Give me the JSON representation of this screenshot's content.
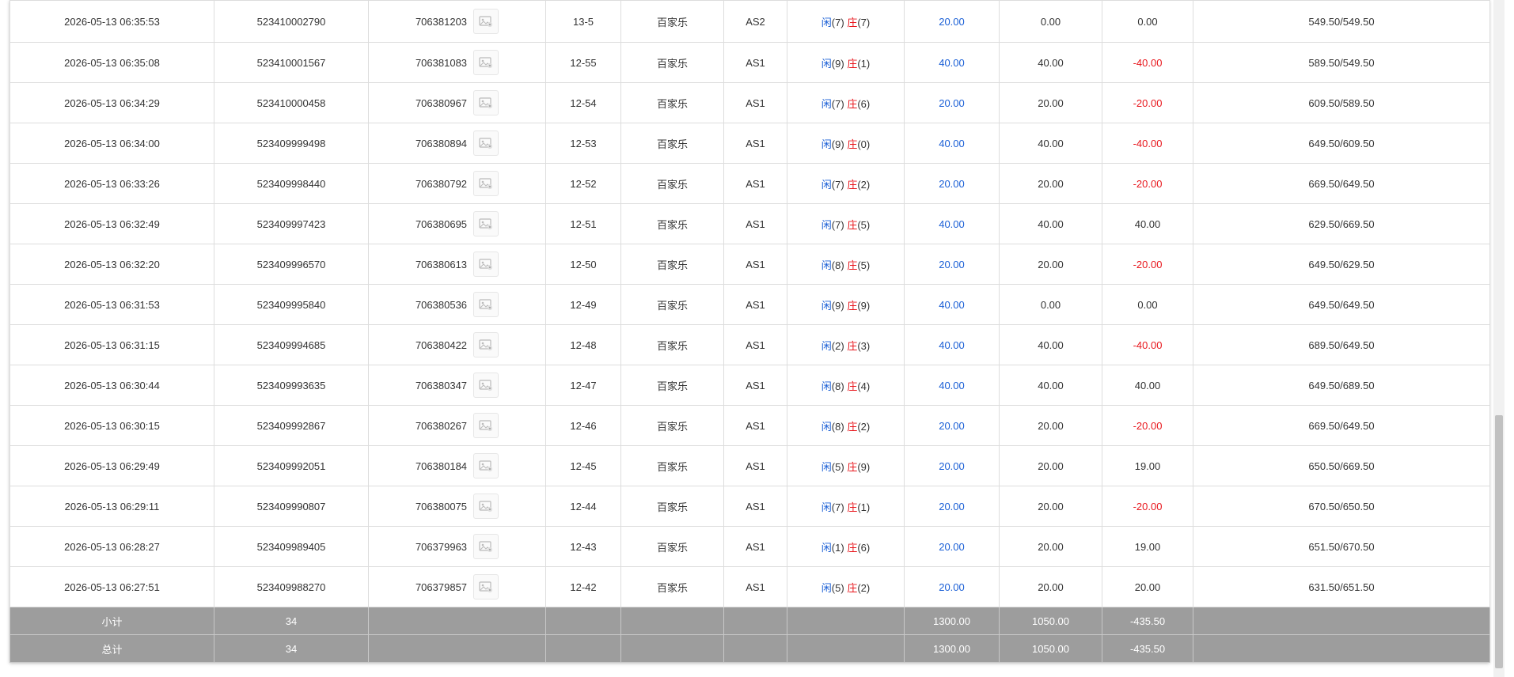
{
  "colors": {
    "player": "#1a5fd6",
    "banker": "#e8161c",
    "summary_bg": "#9d9d9d"
  },
  "rows": [
    {
      "time": "2026-05-13 06:35:53",
      "bet_id": "523410002790",
      "table_id": "706381203",
      "round": "13-5",
      "game": "百家乐",
      "table": "AS2",
      "player_label": "闲",
      "player_pts": "(7)",
      "banker_label": "庄",
      "banker_pts": "(7)",
      "bet": "20.00",
      "valid": "0.00",
      "win": "0.00",
      "win_neg": false,
      "balance": "549.50/549.50"
    },
    {
      "time": "2026-05-13 06:35:08",
      "bet_id": "523410001567",
      "table_id": "706381083",
      "round": "12-55",
      "game": "百家乐",
      "table": "AS1",
      "player_label": "闲",
      "player_pts": "(9)",
      "banker_label": "庄",
      "banker_pts": "(1)",
      "bet": "40.00",
      "valid": "40.00",
      "win": "-40.00",
      "win_neg": true,
      "balance": "589.50/549.50"
    },
    {
      "time": "2026-05-13 06:34:29",
      "bet_id": "523410000458",
      "table_id": "706380967",
      "round": "12-54",
      "game": "百家乐",
      "table": "AS1",
      "player_label": "闲",
      "player_pts": "(7)",
      "banker_label": "庄",
      "banker_pts": "(6)",
      "bet": "20.00",
      "valid": "20.00",
      "win": "-20.00",
      "win_neg": true,
      "balance": "609.50/589.50"
    },
    {
      "time": "2026-05-13 06:34:00",
      "bet_id": "523409999498",
      "table_id": "706380894",
      "round": "12-53",
      "game": "百家乐",
      "table": "AS1",
      "player_label": "闲",
      "player_pts": "(9)",
      "banker_label": "庄",
      "banker_pts": "(0)",
      "bet": "40.00",
      "valid": "40.00",
      "win": "-40.00",
      "win_neg": true,
      "balance": "649.50/609.50"
    },
    {
      "time": "2026-05-13 06:33:26",
      "bet_id": "523409998440",
      "table_id": "706380792",
      "round": "12-52",
      "game": "百家乐",
      "table": "AS1",
      "player_label": "闲",
      "player_pts": "(7)",
      "banker_label": "庄",
      "banker_pts": "(2)",
      "bet": "20.00",
      "valid": "20.00",
      "win": "-20.00",
      "win_neg": true,
      "balance": "669.50/649.50"
    },
    {
      "time": "2026-05-13 06:32:49",
      "bet_id": "523409997423",
      "table_id": "706380695",
      "round": "12-51",
      "game": "百家乐",
      "table": "AS1",
      "player_label": "闲",
      "player_pts": "(7)",
      "banker_label": "庄",
      "banker_pts": "(5)",
      "bet": "40.00",
      "valid": "40.00",
      "win": "40.00",
      "win_neg": false,
      "balance": "629.50/669.50"
    },
    {
      "time": "2026-05-13 06:32:20",
      "bet_id": "523409996570",
      "table_id": "706380613",
      "round": "12-50",
      "game": "百家乐",
      "table": "AS1",
      "player_label": "闲",
      "player_pts": "(8)",
      "banker_label": "庄",
      "banker_pts": "(5)",
      "bet": "20.00",
      "valid": "20.00",
      "win": "-20.00",
      "win_neg": true,
      "balance": "649.50/629.50"
    },
    {
      "time": "2026-05-13 06:31:53",
      "bet_id": "523409995840",
      "table_id": "706380536",
      "round": "12-49",
      "game": "百家乐",
      "table": "AS1",
      "player_label": "闲",
      "player_pts": "(9)",
      "banker_label": "庄",
      "banker_pts": "(9)",
      "bet": "40.00",
      "valid": "0.00",
      "win": "0.00",
      "win_neg": false,
      "balance": "649.50/649.50"
    },
    {
      "time": "2026-05-13 06:31:15",
      "bet_id": "523409994685",
      "table_id": "706380422",
      "round": "12-48",
      "game": "百家乐",
      "table": "AS1",
      "player_label": "闲",
      "player_pts": "(2)",
      "banker_label": "庄",
      "banker_pts": "(3)",
      "bet": "40.00",
      "valid": "40.00",
      "win": "-40.00",
      "win_neg": true,
      "balance": "689.50/649.50"
    },
    {
      "time": "2026-05-13 06:30:44",
      "bet_id": "523409993635",
      "table_id": "706380347",
      "round": "12-47",
      "game": "百家乐",
      "table": "AS1",
      "player_label": "闲",
      "player_pts": "(8)",
      "banker_label": "庄",
      "banker_pts": "(4)",
      "bet": "40.00",
      "valid": "40.00",
      "win": "40.00",
      "win_neg": false,
      "balance": "649.50/689.50"
    },
    {
      "time": "2026-05-13 06:30:15",
      "bet_id": "523409992867",
      "table_id": "706380267",
      "round": "12-46",
      "game": "百家乐",
      "table": "AS1",
      "player_label": "闲",
      "player_pts": "(8)",
      "banker_label": "庄",
      "banker_pts": "(2)",
      "bet": "20.00",
      "valid": "20.00",
      "win": "-20.00",
      "win_neg": true,
      "balance": "669.50/649.50"
    },
    {
      "time": "2026-05-13 06:29:49",
      "bet_id": "523409992051",
      "table_id": "706380184",
      "round": "12-45",
      "game": "百家乐",
      "table": "AS1",
      "player_label": "闲",
      "player_pts": "(5)",
      "banker_label": "庄",
      "banker_pts": "(9)",
      "bet": "20.00",
      "valid": "20.00",
      "win": "19.00",
      "win_neg": false,
      "balance": "650.50/669.50"
    },
    {
      "time": "2026-05-13 06:29:11",
      "bet_id": "523409990807",
      "table_id": "706380075",
      "round": "12-44",
      "game": "百家乐",
      "table": "AS1",
      "player_label": "闲",
      "player_pts": "(7)",
      "banker_label": "庄",
      "banker_pts": "(1)",
      "bet": "20.00",
      "valid": "20.00",
      "win": "-20.00",
      "win_neg": true,
      "balance": "670.50/650.50"
    },
    {
      "time": "2026-05-13 06:28:27",
      "bet_id": "523409989405",
      "table_id": "706379963",
      "round": "12-43",
      "game": "百家乐",
      "table": "AS1",
      "player_label": "闲",
      "player_pts": "(1)",
      "banker_label": "庄",
      "banker_pts": "(6)",
      "bet": "20.00",
      "valid": "20.00",
      "win": "19.00",
      "win_neg": false,
      "balance": "651.50/670.50"
    },
    {
      "time": "2026-05-13 06:27:51",
      "bet_id": "523409988270",
      "table_id": "706379857",
      "round": "12-42",
      "game": "百家乐",
      "table": "AS1",
      "player_label": "闲",
      "player_pts": "(5)",
      "banker_label": "庄",
      "banker_pts": "(2)",
      "bet": "20.00",
      "valid": "20.00",
      "win": "20.00",
      "win_neg": false,
      "balance": "631.50/651.50"
    }
  ],
  "subtotal": {
    "label": "小计",
    "count": "34",
    "bet": "1300.00",
    "valid": "1050.00",
    "win": "-435.50"
  },
  "total": {
    "label": "总计",
    "count": "34",
    "bet": "1300.00",
    "valid": "1050.00",
    "win": "-435.50"
  },
  "icons": {
    "thumb": "photo-preview-icon"
  }
}
